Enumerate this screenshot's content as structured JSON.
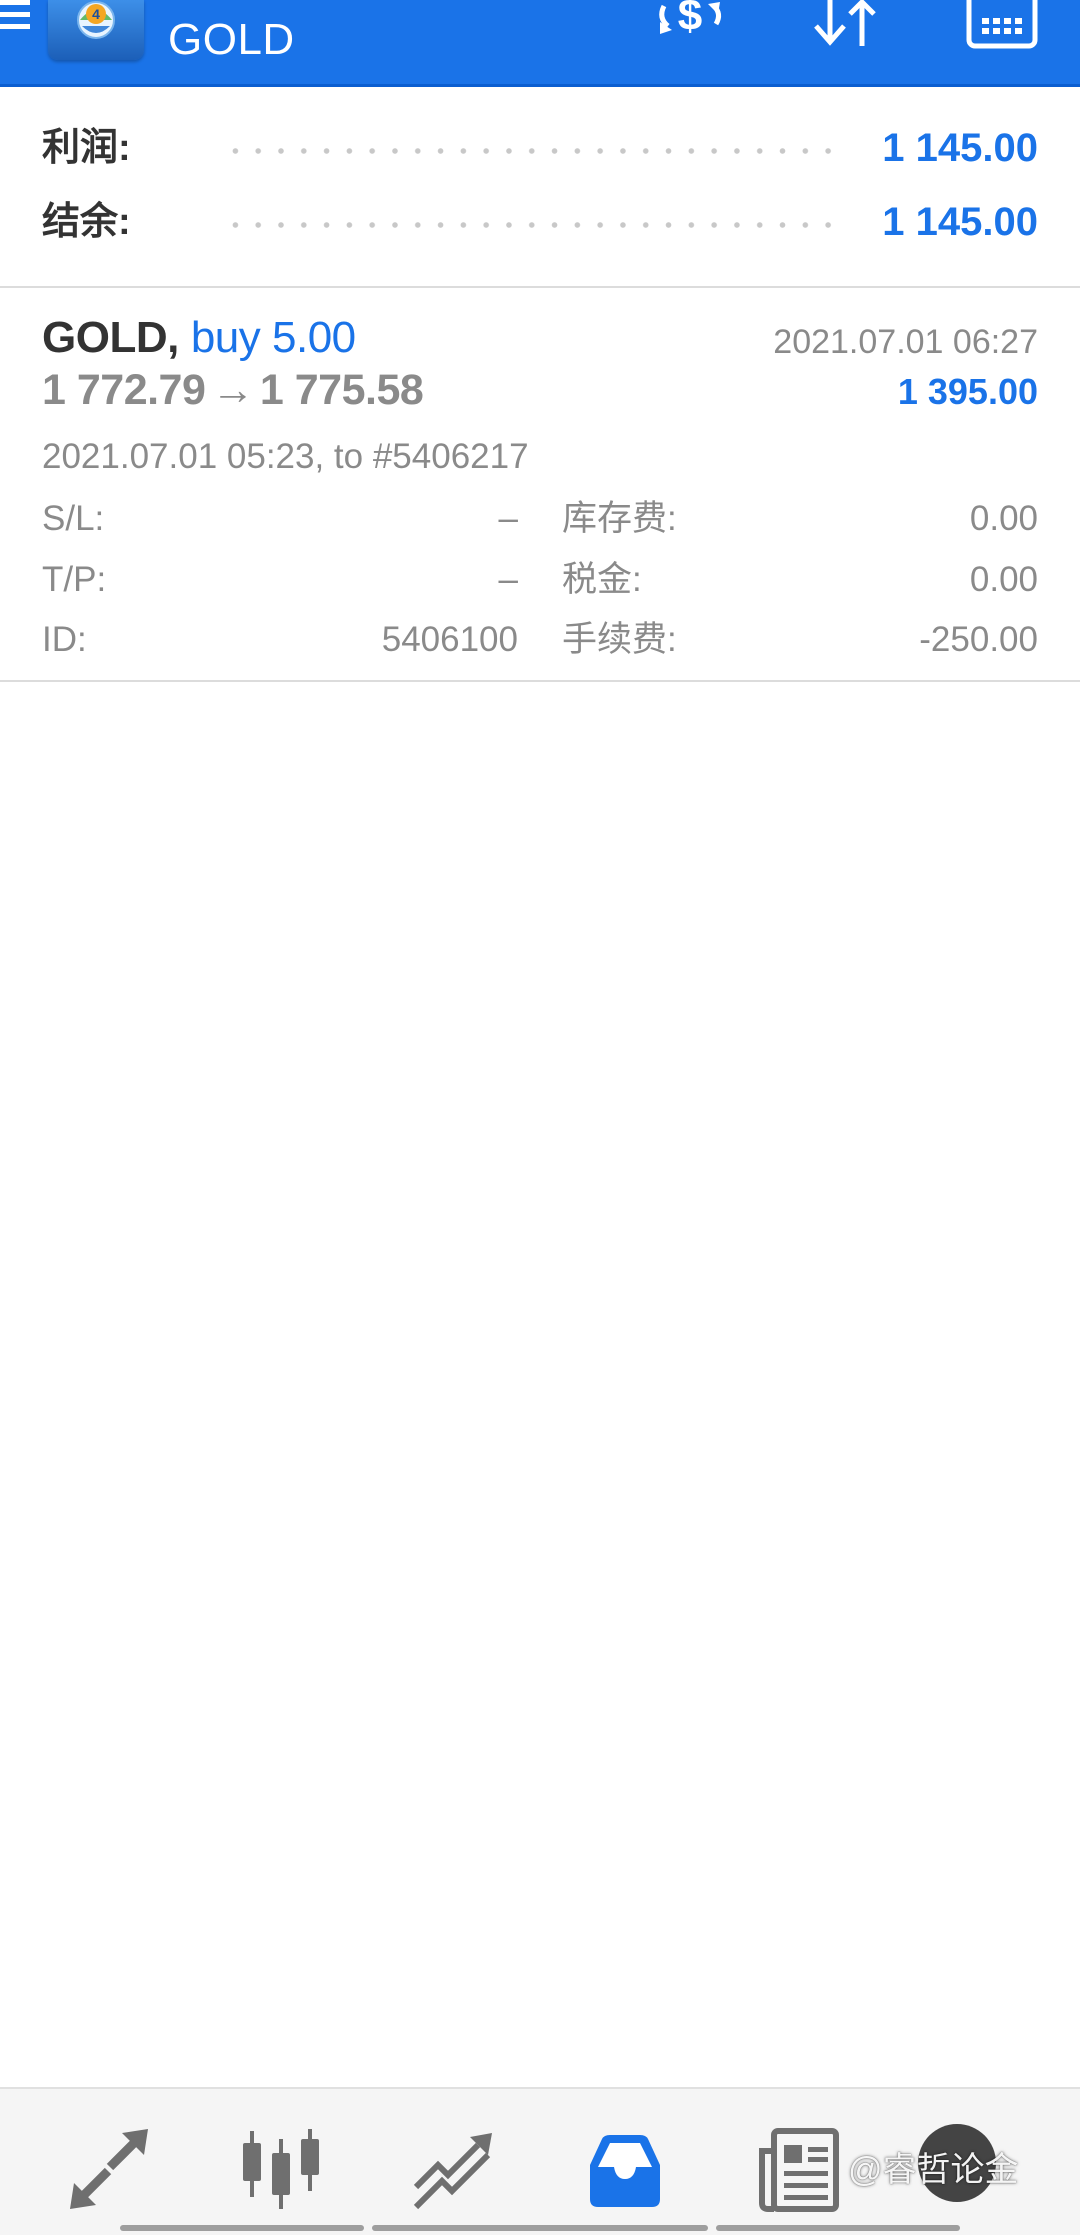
{
  "appbar": {
    "title": "GOLD",
    "background": "#1a73e8",
    "icons": [
      "menu-icon",
      "app-logo",
      "dollar-arrows-icon",
      "sort-arrows-icon",
      "calculator-icon"
    ]
  },
  "summary": {
    "profit_label": "利润:",
    "profit_value": "1 145.00",
    "balance_label": "结余:",
    "balance_value": "1 145.00",
    "value_color": "#1a73e8"
  },
  "position": {
    "symbol": "GOLD,",
    "side": "buy 5.00",
    "open_price": "1 772.79",
    "arrow": "→",
    "close_price": "1 775.58",
    "close_time": "2021.07.01 06:27",
    "profit": "1 395.00",
    "open_info": "2021.07.01 05:23, to #5406217",
    "sl_label": "S/L:",
    "sl_value": "–",
    "tp_label": "T/P:",
    "tp_value": "–",
    "id_label": "ID:",
    "id_value": "5406100",
    "swap_label": "库存费:",
    "swap_value": "0.00",
    "taxes_label": "税金:",
    "taxes_value": "0.00",
    "commission_label": "手续费:",
    "commission_value": "-250.00"
  },
  "bottom_nav": {
    "items": [
      "quotes-icon",
      "chart-icon",
      "trade-icon",
      "history-icon",
      "news-icon",
      "chat-icon"
    ],
    "active": "history-icon",
    "active_color": "#1a73e8",
    "inactive_color": "#6f6f6f"
  },
  "watermark": {
    "text": "@睿哲论金"
  }
}
